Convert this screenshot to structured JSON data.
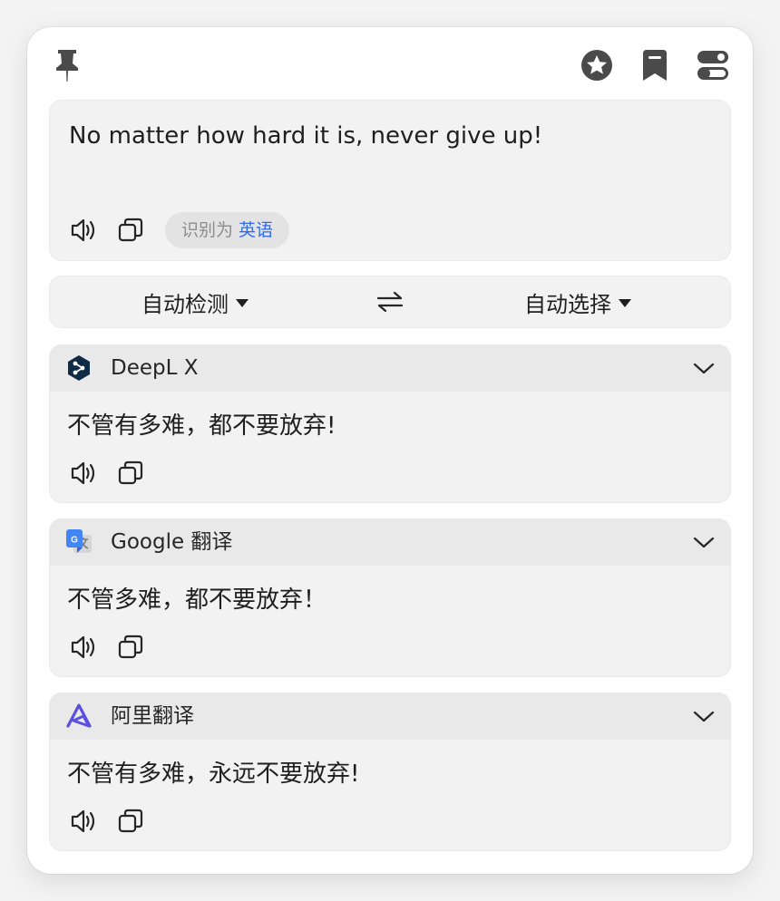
{
  "toolbar": {
    "pin_icon": "pin-icon",
    "favorite_icon": "star-icon",
    "bookmark_icon": "bookmark-icon",
    "settings_icon": "toggle-icon"
  },
  "source": {
    "text": "No matter how hard it is, never give up!",
    "detect_prefix": "识别为",
    "detect_language": "英语"
  },
  "languages": {
    "from": "自动检测",
    "to": "自动选择",
    "swap_icon": "swap-arrows-icon"
  },
  "services": [
    {
      "name": "DeepL X",
      "logo": "deepl-logo",
      "result": "不管有多难，都不要放弃!"
    },
    {
      "name": "Google 翻译",
      "logo": "google-translate-logo",
      "result": "不管多难，都不要放弃！"
    },
    {
      "name": "阿里翻译",
      "logo": "alibaba-translate-logo",
      "result": "不管有多难，永远不要放弃!"
    }
  ],
  "colors": {
    "accent": "#2f6bea",
    "icon_gray": "#4a4a4a",
    "card_bg": "#f2f2f2",
    "card_header_bg": "#e9e9e9",
    "deepl_navy": "#0f2b46",
    "alibaba_purple": "#5b4fe0"
  }
}
